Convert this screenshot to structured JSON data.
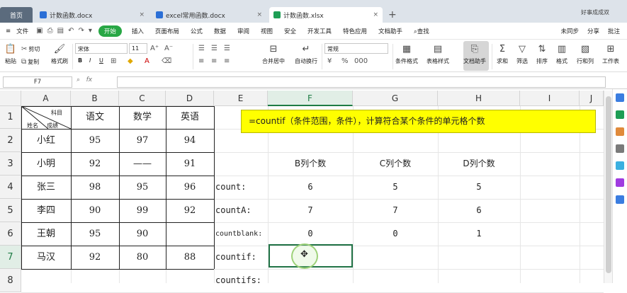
{
  "tabs": [
    {
      "label": "首页"
    },
    {
      "label": "计数函数.docx"
    },
    {
      "label": "excel常用函数.docx"
    },
    {
      "label": "计数函数.xlsx"
    }
  ],
  "account_label": "好事成成双",
  "menu": {
    "file": "文件",
    "start": "开始",
    "items": [
      "插入",
      "页面布局",
      "公式",
      "数据",
      "审阅",
      "视图",
      "安全",
      "开发工具",
      "特色应用",
      "文档助手",
      "查找"
    ],
    "right": [
      "未同步",
      "分享",
      "批注"
    ]
  },
  "ribbon": {
    "paste": "粘贴",
    "cut": "剪切",
    "copy": "复制",
    "format_painter": "格式刷",
    "font_name": "宋体",
    "font_size": "11",
    "merge": "合并居中",
    "wrap": "自动换行",
    "number_format": "常规",
    "cond_format": "条件格式",
    "table_style": "表格样式",
    "doc_assist": "文档助手",
    "sum": "求和",
    "filter": "筛选",
    "sort": "排序",
    "format": "格式",
    "row_col": "行和列",
    "sheet": "工作表"
  },
  "formula_bar": {
    "cell_ref": "F7",
    "fx": "fx",
    "value": ""
  },
  "columns": [
    "A",
    "B",
    "C",
    "D",
    "E",
    "F",
    "G",
    "H",
    "I",
    "J"
  ],
  "rows": [
    "1",
    "2",
    "3",
    "4",
    "5",
    "6",
    "7",
    "8"
  ],
  "header_cell": {
    "top": "科目",
    "bottom_left": "姓名",
    "bottom_mid": "成绩"
  },
  "table_headers": [
    "语文",
    "数学",
    "英语"
  ],
  "students": [
    {
      "name": "小红",
      "c": "95",
      "m": "97",
      "e": "94"
    },
    {
      "name": "小明",
      "c": "92",
      "m": "——",
      "e": "91"
    },
    {
      "name": "张三",
      "c": "98",
      "m": "95",
      "e": "96"
    },
    {
      "name": "李四",
      "c": "90",
      "m": "99",
      "e": "92"
    },
    {
      "name": "王朝",
      "c": "95",
      "m": "90",
      "e": ""
    },
    {
      "name": "马汉",
      "c": "92",
      "m": "80",
      "e": "88"
    }
  ],
  "note": "=countif（条件范围，条件），计算符合某个条件的单元格个数",
  "count_headers": [
    "B列个数",
    "C列个数",
    "D列个数"
  ],
  "func_rows": [
    {
      "label": "count:",
      "b": "6",
      "c": "5",
      "d": "5"
    },
    {
      "label": "countA:",
      "b": "7",
      "c": "7",
      "d": "6"
    },
    {
      "label": "countblank:",
      "b": "0",
      "c": "0",
      "d": "1"
    },
    {
      "label": "countif:",
      "b": "",
      "c": "",
      "d": ""
    },
    {
      "label": "countifs:",
      "b": "",
      "c": "",
      "d": ""
    }
  ],
  "colors": {
    "accent": "#217346",
    "start": "#28a745",
    "highlight": "#ffff00"
  }
}
